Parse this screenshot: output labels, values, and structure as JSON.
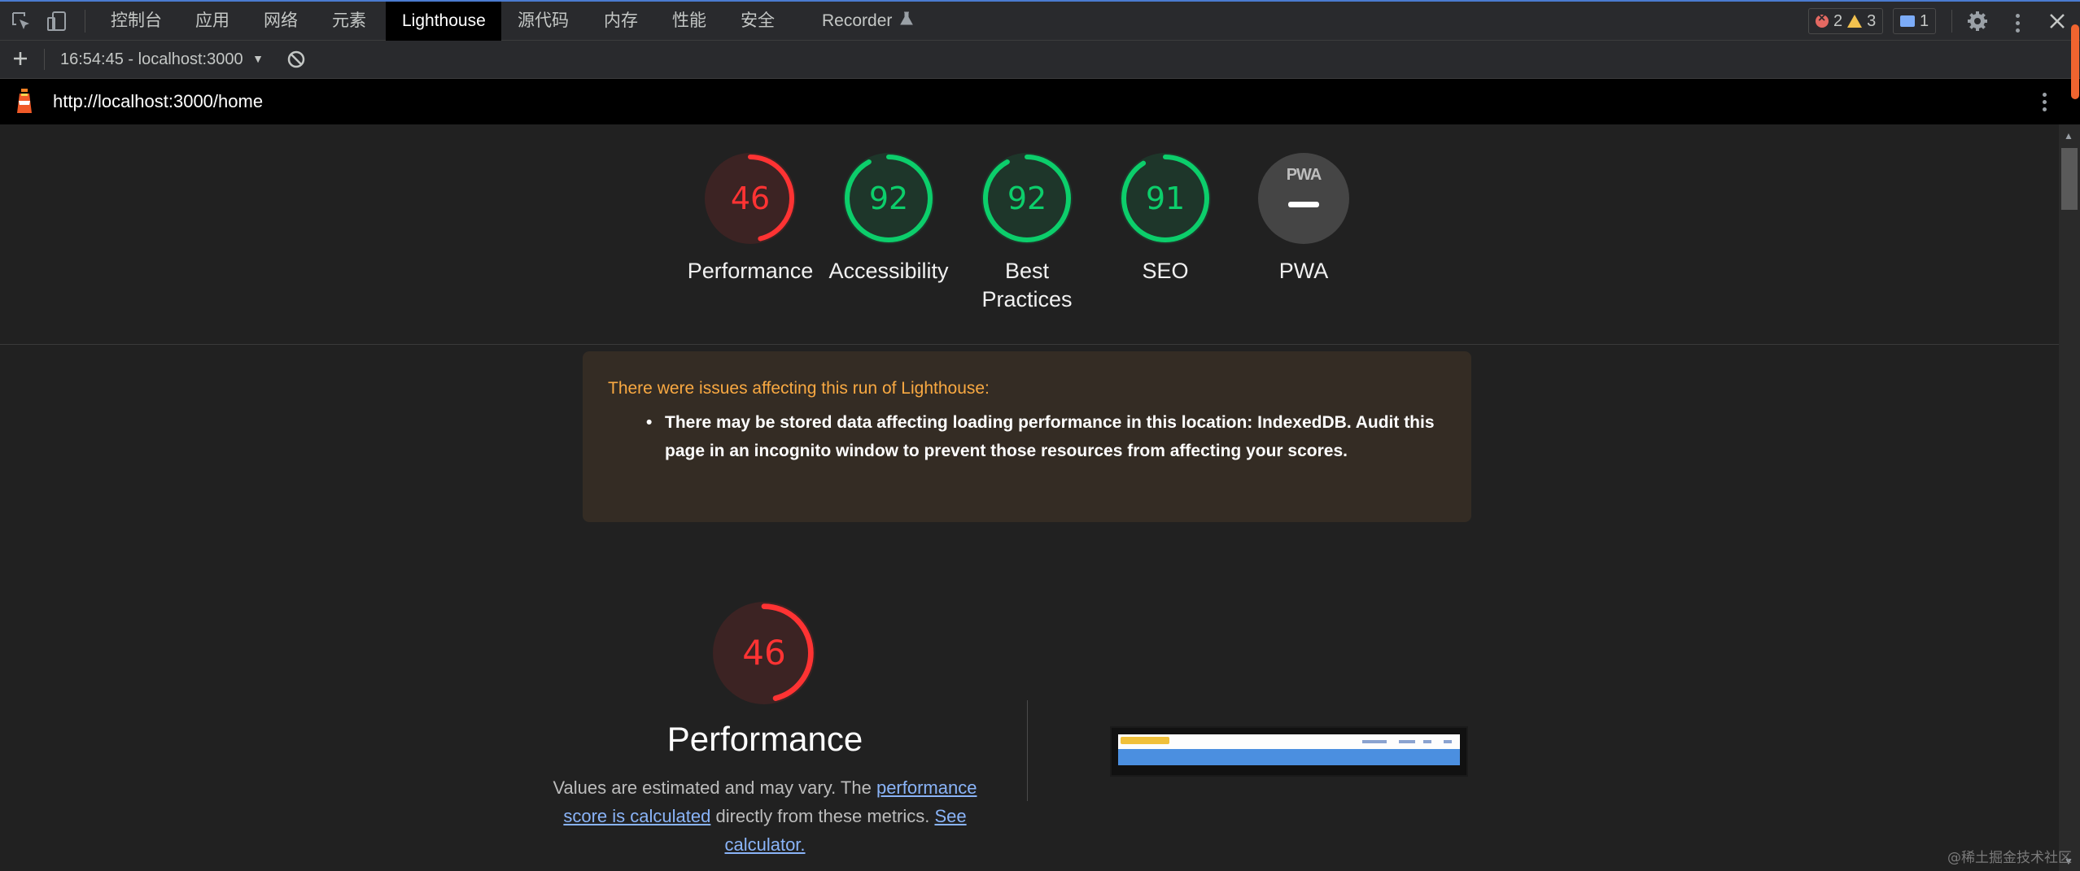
{
  "devtools": {
    "tabs": [
      "控制台",
      "应用",
      "网络",
      "元素",
      "Lighthouse",
      "源代码",
      "内存",
      "性能",
      "安全",
      "Recorder"
    ],
    "active_tab": "Lighthouse",
    "errors": "2",
    "warnings": "3",
    "messages": "1"
  },
  "toolbar": {
    "report_selector": "16:54:45 - localhost:3000"
  },
  "report": {
    "url": "http://localhost:3000/home",
    "categories": [
      {
        "label": "Performance",
        "score": "46",
        "value": 46,
        "color": "#ff3333"
      },
      {
        "label": "Accessibility",
        "score": "92",
        "value": 92,
        "color": "#0cce6b"
      },
      {
        "label": "Best",
        "label2": "Practices",
        "score": "92",
        "value": 92,
        "color": "#0cce6b"
      },
      {
        "label": "SEO",
        "score": "91",
        "value": 91,
        "color": "#0cce6b"
      },
      {
        "label": "PWA",
        "badge": "PWA"
      }
    ],
    "warning": {
      "title": "There were issues affecting this run of Lighthouse:",
      "items": [
        "There may be stored data affecting loading performance in this location: IndexedDB. Audit this page in an incognito window to prevent those resources from affecting your scores."
      ]
    },
    "performance": {
      "score": "46",
      "value": 46,
      "title": "Performance",
      "desc_1": "Values are estimated and may vary. The",
      "link_1": "performance score is calculated",
      "desc_2": "directly from these metrics.",
      "link_2": "See calculator."
    }
  },
  "watermark": "@稀土掘金技术社区"
}
